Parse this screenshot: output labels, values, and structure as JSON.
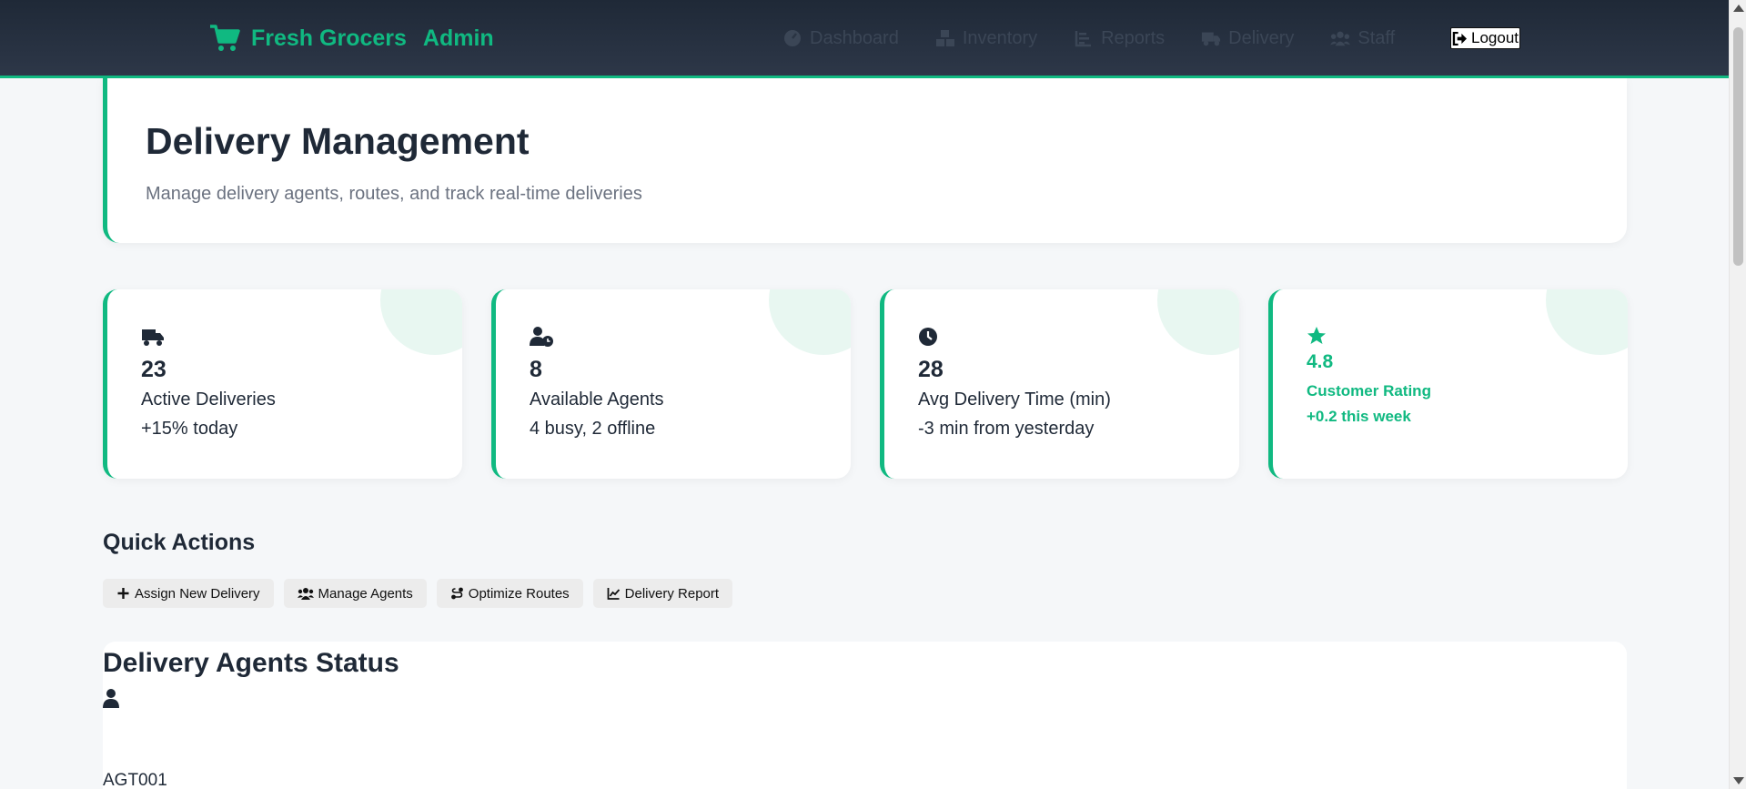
{
  "brand": {
    "name": "Fresh Grocers",
    "suffix": "Admin",
    "icon": "cart-icon",
    "color": "#10b981"
  },
  "nav": {
    "items": [
      {
        "label": "Dashboard",
        "icon": "dashboard-icon"
      },
      {
        "label": "Inventory",
        "icon": "boxes-icon"
      },
      {
        "label": "Reports",
        "icon": "chart-icon"
      },
      {
        "label": "Delivery",
        "icon": "truck-icon"
      },
      {
        "label": "Staff",
        "icon": "users-icon"
      }
    ],
    "logout_label": "Logout"
  },
  "header": {
    "title": "Delivery Management",
    "subtitle": "Manage delivery agents, routes, and track real-time deliveries"
  },
  "stats": [
    {
      "icon": "truck-icon",
      "value": "23",
      "label": "Active Deliveries",
      "trend": "+15% today"
    },
    {
      "icon": "user-clock-icon",
      "value": "8",
      "label": "Available Agents",
      "trend": "4 busy, 2 offline"
    },
    {
      "icon": "clock-icon",
      "value": "28",
      "label": "Avg Delivery Time (min)",
      "trend": "-3 min from yesterday"
    },
    {
      "icon": "star-icon",
      "value": "4.8",
      "label": "Customer Rating",
      "trend": "+0.2 this week"
    }
  ],
  "quick_actions": {
    "title": "Quick Actions",
    "buttons": [
      {
        "label": "Assign New Delivery",
        "icon": "plus-icon"
      },
      {
        "label": "Manage Agents",
        "icon": "users-icon"
      },
      {
        "label": "Optimize Routes",
        "icon": "route-icon"
      },
      {
        "label": "Delivery Report",
        "icon": "line-chart-icon"
      }
    ]
  },
  "agents": {
    "title": "Delivery Agents Status",
    "first_agent": {
      "icon": "user-icon",
      "id": "AGT001"
    }
  }
}
